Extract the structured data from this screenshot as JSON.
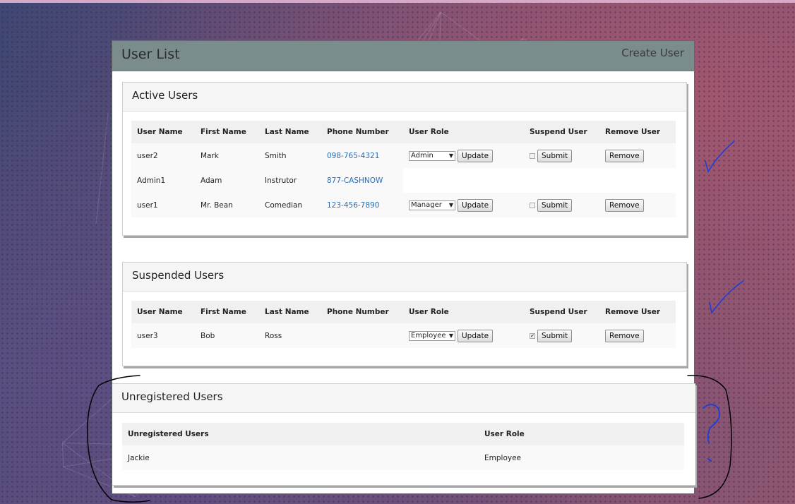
{
  "header": {
    "title": "User List",
    "create_link": "Create User"
  },
  "active": {
    "title": "Active Users",
    "columns": [
      "User Name",
      "First Name",
      "Last Name",
      "Phone Number",
      "User Role",
      "Suspend User",
      "Remove User"
    ],
    "rows": [
      {
        "username": "user2",
        "first": "Mark",
        "last": "Smith",
        "phone": "098-765-4321",
        "role": "Admin",
        "update": "Update",
        "suspended": false,
        "submit": "Submit",
        "remove": "Remove"
      },
      {
        "username": "Admin1",
        "first": "Adam",
        "last": "Instrutor",
        "phone": "877-CASHNOW"
      },
      {
        "username": "user1",
        "first": "Mr. Bean",
        "last": "Comedian",
        "phone": "123-456-7890",
        "role": "Manager",
        "update": "Update",
        "suspended": false,
        "submit": "Submit",
        "remove": "Remove"
      }
    ]
  },
  "suspended": {
    "title": "Suspended Users",
    "columns": [
      "User Name",
      "First Name",
      "Last Name",
      "Phone Number",
      "User Role",
      "Suspend User",
      "Remove User"
    ],
    "rows": [
      {
        "username": "user3",
        "first": "Bob",
        "last": "Ross",
        "phone": "",
        "role": "Employee",
        "update": "Update",
        "suspended": true,
        "submit": "Submit",
        "remove": "Remove"
      }
    ]
  },
  "unregistered": {
    "title": "Unregistered Users",
    "columns": [
      "Unregistered Users",
      "User Role"
    ],
    "rows": [
      {
        "name": "Jackie",
        "role": "Employee"
      }
    ]
  },
  "colors": {
    "header_bg": "#7b8c8c",
    "link": "#2a6db0",
    "annotation_blue": "#1e3fd6",
    "annotation_black": "#000000"
  }
}
